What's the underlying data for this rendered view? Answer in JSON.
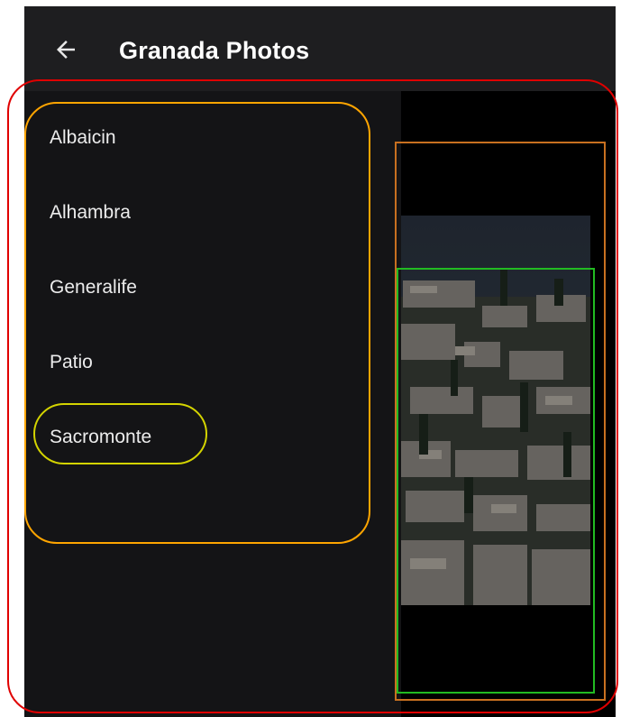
{
  "app_bar": {
    "title": "Granada Photos",
    "back_icon": "arrow-left-icon"
  },
  "drawer": {
    "items": [
      {
        "label": "Albaicin"
      },
      {
        "label": "Alhambra"
      },
      {
        "label": "Generalife"
      },
      {
        "label": "Patio"
      },
      {
        "label": "Sacromonte"
      }
    ]
  },
  "photo": {
    "description_icon": "granada-city-photo"
  },
  "colors": {
    "app_bar_bg": "#1e1e20",
    "drawer_bg": "#141416",
    "screen_bg": "#000000",
    "text": "#ececec",
    "annotation_red": "#e00000",
    "annotation_orange": "#ffa500",
    "annotation_yellow": "#d4d400",
    "annotation_brown": "#c87020",
    "annotation_green": "#22bb22"
  }
}
